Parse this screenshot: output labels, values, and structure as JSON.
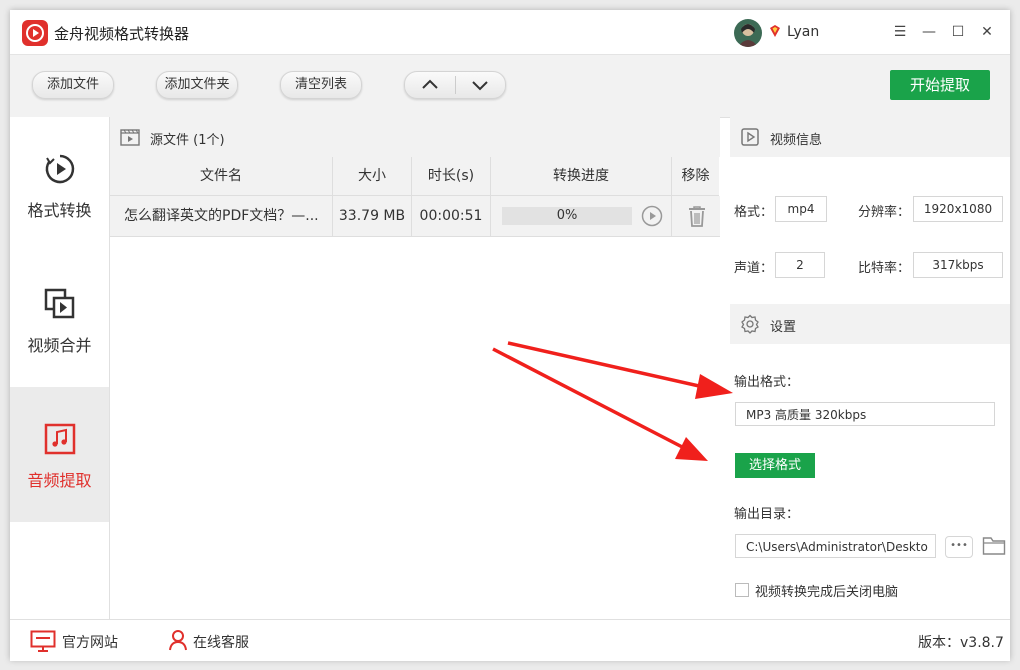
{
  "app": {
    "title": "金舟视频格式转换器",
    "username": "Lyan"
  },
  "window_controls": {
    "menu": "☰",
    "minimize": "—",
    "maximize": "☐",
    "close": "✕"
  },
  "toolbar": {
    "add_file": "添加文件",
    "add_folder": "添加文件夹",
    "clear_list": "清空列表",
    "move_up_icon": "chevron-up-icon",
    "move_down_icon": "chevron-down-icon",
    "start": "开始提取"
  },
  "sidebar": {
    "items": [
      {
        "label": "格式转换",
        "icon": "format-convert-icon",
        "active": false
      },
      {
        "label": "视频合并",
        "icon": "video-merge-icon",
        "active": false
      },
      {
        "label": "音频提取",
        "icon": "audio-extract-icon",
        "active": true
      }
    ]
  },
  "file_list": {
    "title": "源文件 (1个)",
    "columns": [
      "文件名",
      "大小",
      "时长(s)",
      "转换进度",
      "移除"
    ],
    "rows": [
      {
        "name": "怎么翻译英文的PDF文档？—...",
        "size": "33.79 MB",
        "duration": "00:00:51",
        "progress": "0%",
        "progress_value": 0
      }
    ]
  },
  "video_info": {
    "title": "视频信息",
    "format_label": "格式：",
    "format": "mp4",
    "resolution_label": "分辨率：",
    "resolution": "1920x1080",
    "channels_label": "声道：",
    "channels": "2",
    "bitrate_label": "比特率：",
    "bitrate": "317kbps"
  },
  "settings": {
    "title": "设置",
    "output_format_label": "输出格式：",
    "output_format": "MP3 高质量 320kbps",
    "choose_format": "选择格式",
    "output_dir_label": "输出目录：",
    "output_dir": "C:\\Users\\Administrator\\Deskto",
    "more": "•••",
    "shutdown_label": "视频转换完成后关闭电脑",
    "shutdown_checked": false
  },
  "footer": {
    "website": "官方网站",
    "support": "在线客服",
    "version": "版本：v3.8.7"
  },
  "colors": {
    "accent_red": "#e0302c",
    "accent_green": "#1aa34a",
    "annotation_arrow": "#f0201c"
  }
}
